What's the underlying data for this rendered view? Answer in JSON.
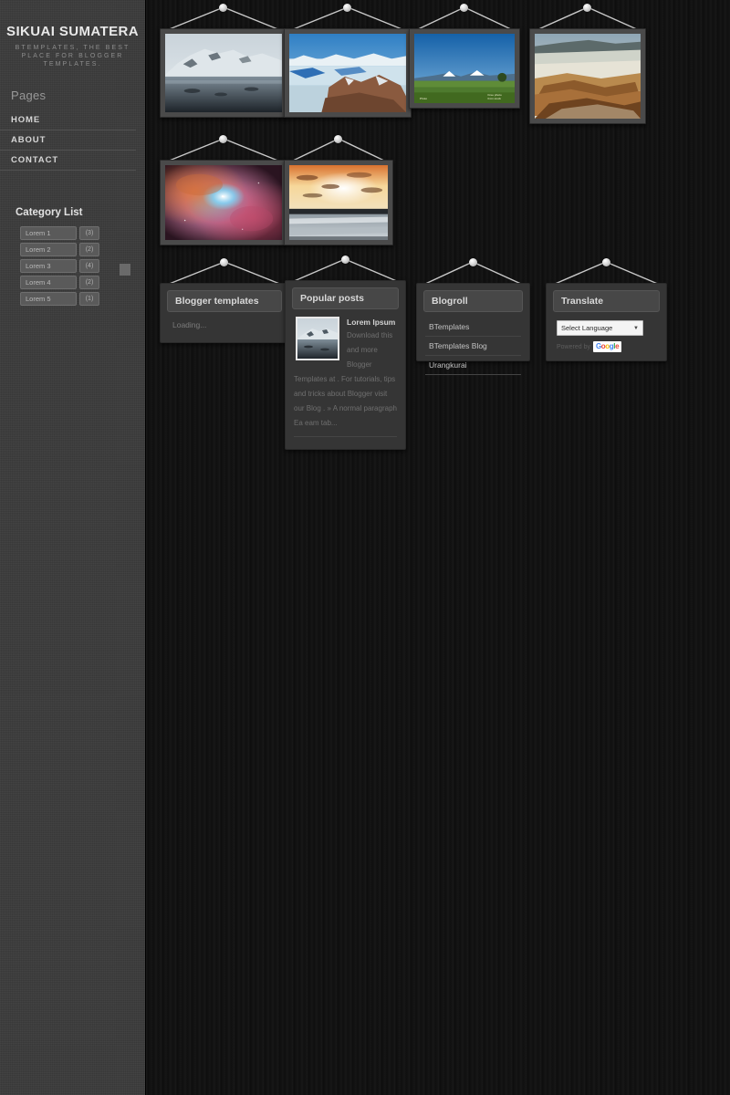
{
  "site": {
    "title": "SIKUAI SUMATERA",
    "description": "BTEMPLATES, THE BEST PLACE FOR BLOGGER TEMPLATES."
  },
  "sidebar": {
    "pages_heading": "Pages",
    "pages": [
      {
        "label": "HOME"
      },
      {
        "label": "ABOUT"
      },
      {
        "label": "CONTACT"
      }
    ],
    "category_heading": "Category List",
    "categories": [
      {
        "label": "Lorem 1",
        "count": "(3)"
      },
      {
        "label": "Lorem 2",
        "count": "(2)"
      },
      {
        "label": "Lorem 3",
        "count": "(4)"
      },
      {
        "label": "Lorem 4",
        "count": "(2)"
      },
      {
        "label": "Lorem 5",
        "count": "(1)"
      }
    ]
  },
  "gallery": {
    "items": [
      {
        "alt": "snow-covered-mountain-reflection"
      },
      {
        "alt": "glacier-and-icy-bay"
      },
      {
        "alt": "green-field-with-distant-volcanoes"
      },
      {
        "alt": "hot-spring-travertine-terraces"
      },
      {
        "alt": "orion-nebula"
      },
      {
        "alt": "beach-sunset-over-ocean"
      }
    ]
  },
  "widgets": {
    "blogger_templates": {
      "title": "Blogger templates",
      "status": "Loading..."
    },
    "popular_posts": {
      "title": "Popular posts",
      "post_title": "Lorem Ipsum",
      "snippet": "Download this and more Blogger Templates at . For tutorials, tips and tricks about Blogger visit our Blog . » A normal paragraph Ea eam tab..."
    },
    "blogroll": {
      "title": "Blogroll",
      "links": [
        {
          "label": "BTemplates"
        },
        {
          "label": "BTemplates Blog"
        },
        {
          "label": "Urangkurai"
        }
      ]
    },
    "translate": {
      "title": "Translate",
      "selected_language": "Select Language",
      "caret": "▼",
      "powered_by": "Powered by",
      "google_logo": "Google"
    }
  }
}
